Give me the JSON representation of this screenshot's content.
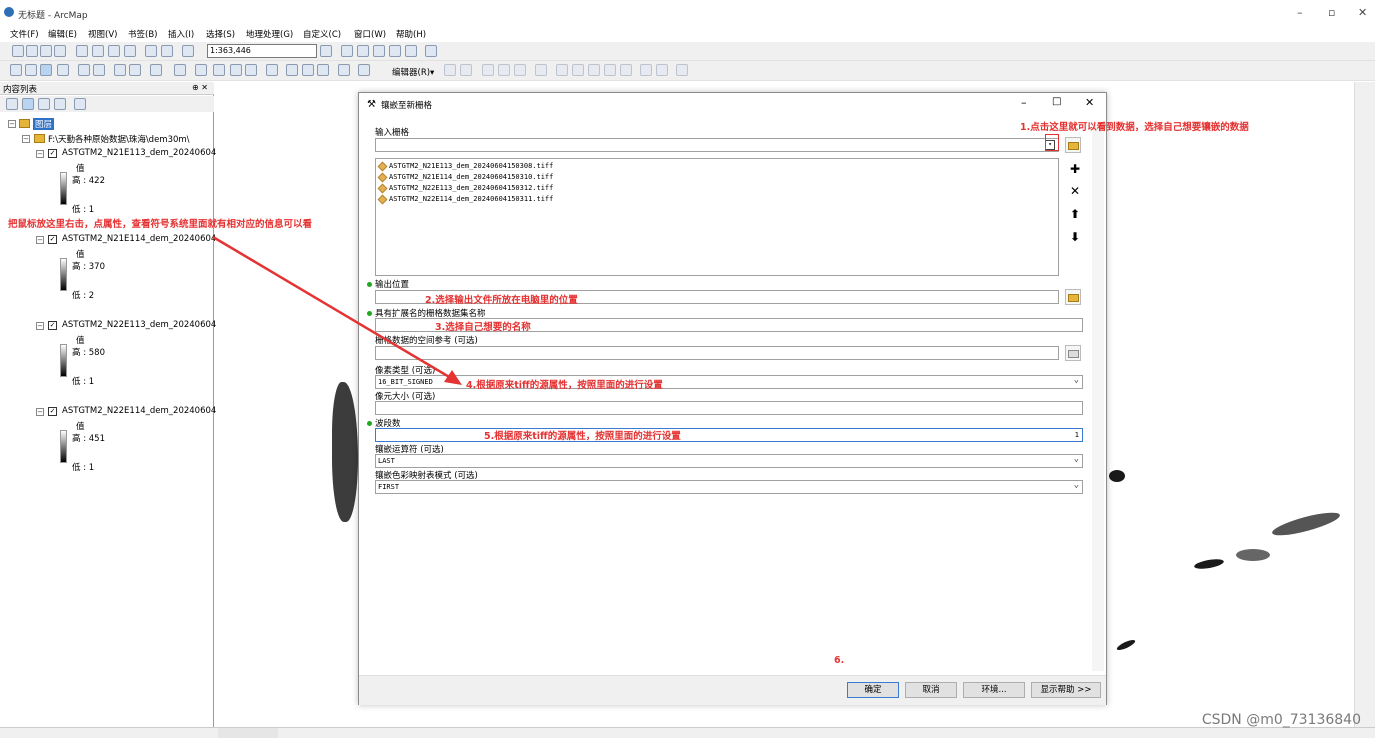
{
  "window": {
    "title": "无标题 - ArcMap"
  },
  "menu": [
    "文件(F)",
    "编辑(E)",
    "视图(V)",
    "书签(B)",
    "插入(I)",
    "选择(S)",
    "地理处理(G)",
    "自定义(C)",
    "窗口(W)",
    "帮助(H)"
  ],
  "toolbar": {
    "scale": "1:363,446",
    "editor": "编辑器(R)▾"
  },
  "toc": {
    "title": "内容列表",
    "pin": "⊕ ✕",
    "root": "图层",
    "folder": "F:\\天勤各种原始数据\\珠海\\dem30m\\",
    "layers": [
      {
        "name": "ASTGTM2_N21E113_dem_20240604",
        "value_label": "值",
        "high": "高 : 422",
        "low": "低 : 1"
      },
      {
        "name": "ASTGTM2_N21E114_dem_20240604",
        "value_label": "值",
        "high": "高 : 370",
        "low": "低 : 2"
      },
      {
        "name": "ASTGTM2_N22E113_dem_20240604",
        "value_label": "值",
        "high": "高 : 580",
        "low": "低 : 1"
      },
      {
        "name": "ASTGTM2_N22E114_dem_20240604",
        "value_label": "值",
        "high": "高 : 451",
        "low": "低 : 1"
      }
    ]
  },
  "dialog": {
    "title": "镶嵌至新栅格",
    "input_label": "输入栅格",
    "files": [
      "ASTGTM2_N21E113_dem_20240604150308.tiff",
      "ASTGTM2_N21E114_dem_20240604150310.tiff",
      "ASTGTM2_N22E113_dem_20240604150312.tiff",
      "ASTGTM2_N22E114_dem_20240604150311.tiff"
    ],
    "output_label": "输出位置",
    "name_label": "具有扩展名的栅格数据集名称",
    "sr_label": "栅格数据的空间参考 (可选)",
    "pixel_label": "像素类型 (可选)",
    "pixel_value": "16_BIT_SIGNED",
    "cellsize_label": "像元大小 (可选)",
    "bands_label": "波段数",
    "bands_value": "1",
    "operator_label": "镶嵌运算符 (可选)",
    "operator_value": "LAST",
    "colormap_label": "镶嵌色彩映射表模式 (可选)",
    "colormap_value": "FIRST",
    "buttons": {
      "ok": "确定",
      "cancel": "取消",
      "env": "环境...",
      "help": "显示帮助 >>"
    }
  },
  "annotations": {
    "a1": "1.点击这里就可以看到数据，选择自己想要镶嵌的数据",
    "a2": "2.选择输出文件所放在电脑里的位置",
    "a3": "3.选择自己想要的名称",
    "a4": "4.根据原来tiff的源属性，按照里面的进行设置",
    "a5": "5.根据原来tiff的源属性，按照里面的进行设置",
    "a6": "6.",
    "left": "把鼠标放这里右击，点属性，查看符号系统里面就有相对应的信息可以看"
  },
  "watermark": "CSDN @m0_73136840"
}
